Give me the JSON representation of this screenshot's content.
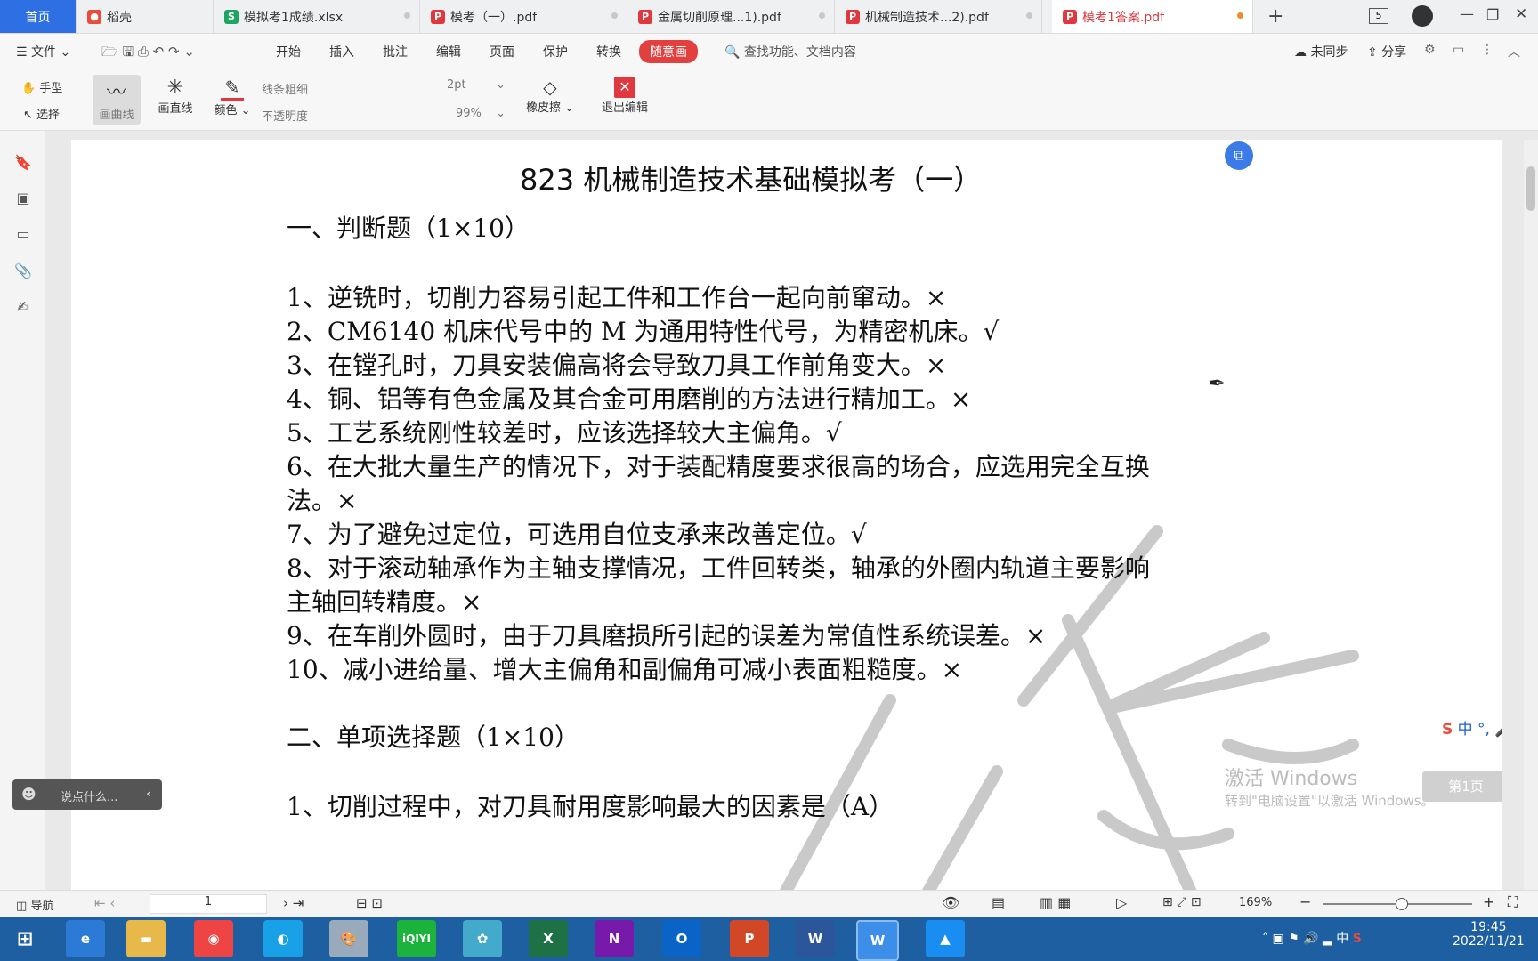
{
  "tabs": [
    {
      "label": "首页",
      "icon": "home"
    },
    {
      "label": "稻壳",
      "icon": "docer-icon"
    },
    {
      "label": "模拟考1成绩.xlsx",
      "icon": "sheet-icon"
    },
    {
      "label": "模考（一）.pdf",
      "icon": "pdf-icon"
    },
    {
      "label": "金属切削原理...1).pdf",
      "icon": "pdf-icon"
    },
    {
      "label": "机械制造技术...2).pdf",
      "icon": "pdf-icon"
    },
    {
      "label": "模考1答案.pdf",
      "icon": "pdf-icon"
    }
  ],
  "tab_count": "5",
  "menu": {
    "file": "文件",
    "items": [
      "开始",
      "插入",
      "批注",
      "编辑",
      "页面",
      "保护",
      "转换"
    ],
    "active": "随意画",
    "search": "查找功能、文档内容",
    "sync": "未同步",
    "share": "分享"
  },
  "ribbon": {
    "hand": "手型",
    "select": "选择",
    "curve": "画曲线",
    "straight": "画直线",
    "color": "颜色",
    "line_weight_label": "线条粗细",
    "line_weight_value": "2pt",
    "opacity_label": "不透明度",
    "opacity_value": "99%",
    "eraser": "橡皮擦",
    "exit": "退出编辑"
  },
  "document": {
    "title": "823 机械制造技术基础模拟考（一）",
    "section1": "一、判断题（1×10）",
    "items": [
      "1、逆铣时，切削力容易引起工件和工作台一起向前窜动。×",
      "2、CM6140 机床代号中的 M 为通用特性代号，为精密机床。√",
      "3、在镗孔时，刀具安装偏高将会导致刀具工作前角变大。×",
      "4、铜、铝等有色金属及其合金可用磨削的方法进行精加工。×",
      "5、工艺系统刚性较差时，应该选择较大主偏角。√",
      "6、在大批大量生产的情况下，对于装配精度要求很高的场合，应选用完全互换",
      "法。×",
      "7、为了避免过定位，可选用自位支承来改善定位。√",
      "8、对于滚动轴承作为主轴支撑情况，工件回转类，轴承的外圈内轨道主要影响",
      "主轴回转精度。×",
      "9、在车削外圆时，由于刀具磨损所引起的误差为常值性系统误差。×",
      "10、减小进给量、增大主偏角和副偏角可减小表面粗糙度。×"
    ],
    "section2": "二、单项选择题（1×10）",
    "partial": "1、切削过程中，对刀具耐用度影响最大的因素是（A）"
  },
  "chat_placeholder": "说点什么...",
  "watermark": {
    "line1": "激活 Windows",
    "line2": "转到\"电脑设置\"以激活 Windows。"
  },
  "page_badge": "第1页",
  "status": {
    "nav": "导航",
    "page": "1",
    "zoom": "169%"
  },
  "taskbar": {
    "time": "19:45",
    "date": "2022/11/21",
    "ime": "中"
  }
}
